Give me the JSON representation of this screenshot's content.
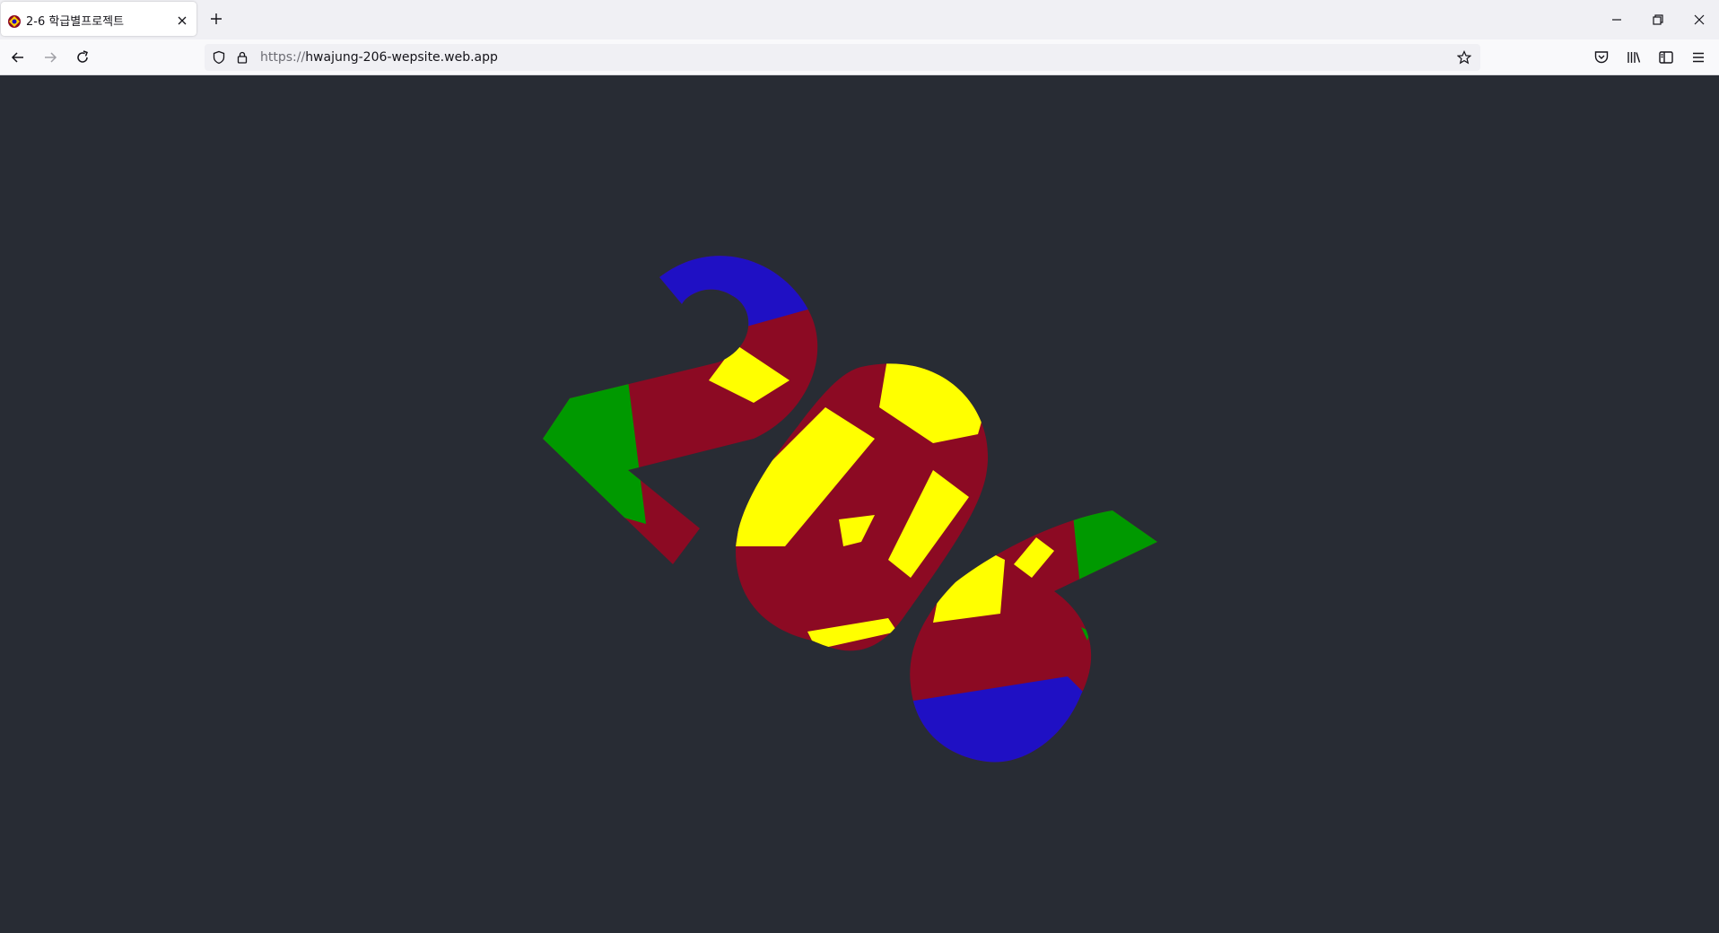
{
  "browser": {
    "tab": {
      "title": "2-6 학급별프로젝트",
      "favicon": "react-logo-icon"
    },
    "url": {
      "scheme": "https://",
      "host": "hwajung-206-wepsite.web.app"
    }
  },
  "page": {
    "background_color": "#282c34",
    "logo_text": "206",
    "logo_colors": [
      "#1f10c4",
      "#8c0a23",
      "#ffff00",
      "#009900"
    ]
  }
}
